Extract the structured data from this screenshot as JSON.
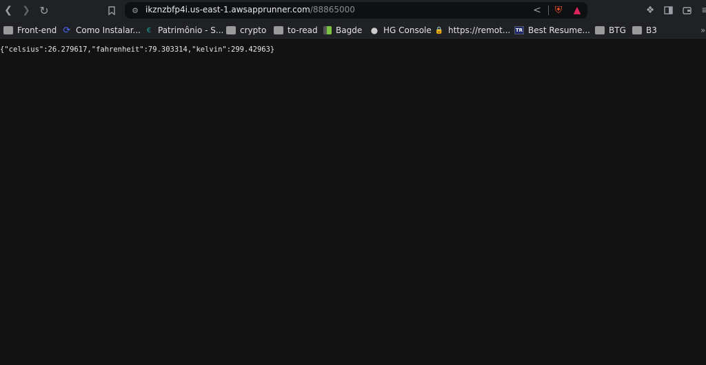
{
  "toolbar": {
    "url_host": "ikznzbfp4i.us-east-1.awsapprunner.com",
    "url_path": "/88865000"
  },
  "bookmarks": [
    {
      "label": "Front-end",
      "icon": "folder-icon"
    },
    {
      "label": "Como Instalar...",
      "icon": "site-icon"
    },
    {
      "label": "Patrimônio - S...",
      "icon": "site-icon"
    },
    {
      "label": "crypto",
      "icon": "folder-icon"
    },
    {
      "label": "to-read",
      "icon": "folder-icon"
    },
    {
      "label": "Bagde",
      "icon": "site-icon"
    },
    {
      "label": "HG Console",
      "icon": "globe-icon"
    },
    {
      "label": "https://remot...",
      "icon": "lock-icon"
    },
    {
      "label": "Best Resume...",
      "icon": "tr-icon"
    },
    {
      "label": "BTG",
      "icon": "folder-icon"
    },
    {
      "label": "B3",
      "icon": "folder-icon"
    }
  ],
  "content": {
    "json_text": "{\"celsius\":26.279617,\"fahrenheit\":79.303314,\"kelvin\":299.42963}"
  },
  "colors": {
    "page_bg": "#121212",
    "toolbar_bg": "#202124",
    "brave_orange": "#fb542b"
  }
}
